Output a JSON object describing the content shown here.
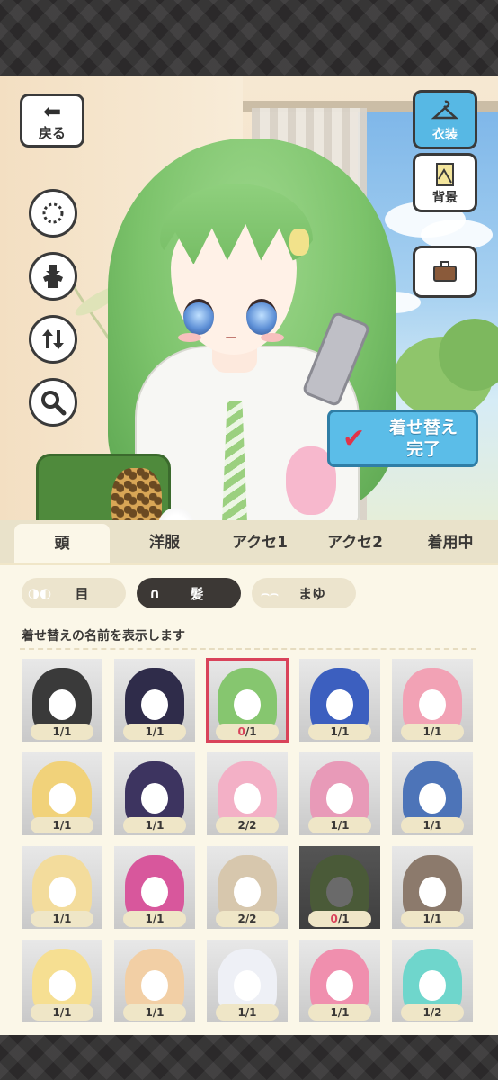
{
  "header": {
    "back_label": "戻る"
  },
  "side_buttons": [
    {
      "label": "衣装",
      "icon": "hanger-icon",
      "active": true
    },
    {
      "label": "背景",
      "icon": "picture-icon",
      "active": false
    },
    {
      "label": "",
      "icon": "suitcase-icon",
      "active": false
    }
  ],
  "tools": [
    {
      "icon": "dashed-circle-icon"
    },
    {
      "icon": "download-shirt-icon"
    },
    {
      "icon": "swap-vertical-icon"
    },
    {
      "icon": "magnifier-icon"
    }
  ],
  "done_button": {
    "label": "着せ替え\n完了"
  },
  "tabs": [
    "頭",
    "洋服",
    "アクセ1",
    "アクセ2",
    "着用中"
  ],
  "active_tab": "頭",
  "chips": [
    {
      "label": "目",
      "icon": "eye-icon"
    },
    {
      "label": "髪",
      "icon": "hair-icon",
      "active": true
    },
    {
      "label": "まゆ",
      "icon": "eyebrow-icon"
    }
  ],
  "hint": "着せ替えの名前を表示します",
  "items": [
    {
      "count": "1/1",
      "color": "#3a3a3a"
    },
    {
      "count": "1/1",
      "color": "#2f2c4a"
    },
    {
      "count": "0/1",
      "color": "#86c66f",
      "selected": true
    },
    {
      "count": "1/1",
      "color": "#3c5fbf"
    },
    {
      "count": "1/1",
      "color": "#f2a2b5"
    },
    {
      "count": "1/1",
      "color": "#f1d27a"
    },
    {
      "count": "1/1",
      "color": "#3d3460"
    },
    {
      "count": "2/2",
      "color": "#f3b0c6"
    },
    {
      "count": "1/1",
      "color": "#e89ab8"
    },
    {
      "count": "1/1",
      "color": "#4d74b8"
    },
    {
      "count": "1/1",
      "color": "#f3dc9c"
    },
    {
      "count": "1/1",
      "color": "#d8579c"
    },
    {
      "count": "2/2",
      "color": "#d7c7ad"
    },
    {
      "count": "0/1",
      "color": "#4a5a38",
      "dim": true
    },
    {
      "count": "1/1",
      "color": "#8c7a6c"
    },
    {
      "count": "1/1",
      "color": "#f6df92"
    },
    {
      "count": "1/1",
      "color": "#f2cfa5"
    },
    {
      "count": "1/1",
      "color": "#eef0f6"
    },
    {
      "count": "1/1",
      "color": "#f08fae"
    },
    {
      "count": "1/2",
      "color": "#6fd6cc"
    }
  ]
}
